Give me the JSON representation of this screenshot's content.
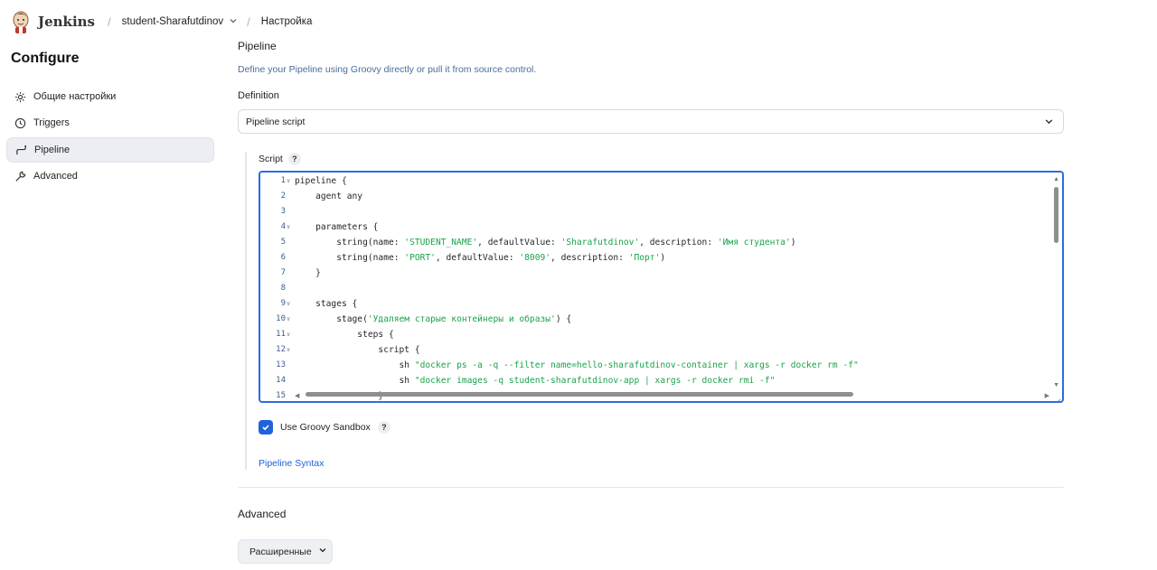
{
  "header": {
    "brand": "Jenkins",
    "breadcrumbs": [
      {
        "label": "student-Sharafutdinov",
        "has_dropdown": true
      },
      {
        "label": "Настройка",
        "has_dropdown": false
      }
    ],
    "separator": "/"
  },
  "sidebar": {
    "title": "Configure",
    "items": [
      {
        "label": "Общие настройки",
        "icon": "gear-icon",
        "active": false
      },
      {
        "label": "Triggers",
        "icon": "clock-icon",
        "active": false
      },
      {
        "label": "Pipeline",
        "icon": "pipeline-icon",
        "active": true
      },
      {
        "label": "Advanced",
        "icon": "wrench-icon",
        "active": false
      }
    ]
  },
  "pipeline": {
    "title": "Pipeline",
    "description": "Define your Pipeline using Groovy directly or pull it from source control.",
    "definition_label": "Definition",
    "definition_value": "Pipeline script",
    "script_label": "Script",
    "help": "?",
    "code_lines": [
      {
        "n": "1",
        "fold": true,
        "text": "pipeline {"
      },
      {
        "n": "2",
        "fold": false,
        "text": "    agent any"
      },
      {
        "n": "3",
        "fold": false,
        "text": ""
      },
      {
        "n": "4",
        "fold": true,
        "text": "    parameters {"
      },
      {
        "n": "5",
        "fold": false,
        "text": "        string(name: 'STUDENT_NAME', defaultValue: 'Sharafutdinov', description: 'Имя студента')"
      },
      {
        "n": "6",
        "fold": false,
        "text": "        string(name: 'PORT', defaultValue: '8009', description: 'Порт')"
      },
      {
        "n": "7",
        "fold": false,
        "text": "    }"
      },
      {
        "n": "8",
        "fold": false,
        "text": ""
      },
      {
        "n": "9",
        "fold": true,
        "text": "    stages {"
      },
      {
        "n": "10",
        "fold": true,
        "text": "        stage('Удаляем старые контейнеры и образы') {"
      },
      {
        "n": "11",
        "fold": true,
        "text": "            steps {"
      },
      {
        "n": "12",
        "fold": true,
        "text": "                script {"
      },
      {
        "n": "13",
        "fold": false,
        "text": "                    sh \"docker ps -a -q --filter name=hello-sharafutdinov-container | xargs -r docker rm -f\""
      },
      {
        "n": "14",
        "fold": false,
        "text": "                    sh \"docker images -q student-sharafutdinov-app | xargs -r docker rmi -f\""
      },
      {
        "n": "15",
        "fold": false,
        "text": "                }"
      }
    ],
    "sandbox_label": "Use Groovy Sandbox",
    "sandbox_checked": true,
    "syntax_link": "Pipeline Syntax"
  },
  "advanced": {
    "title": "Advanced",
    "button_label": "Расширенные"
  },
  "colors": {
    "accent": "#1f63d8",
    "string": "#1aa34a",
    "line_number": "#3b5f8a"
  }
}
